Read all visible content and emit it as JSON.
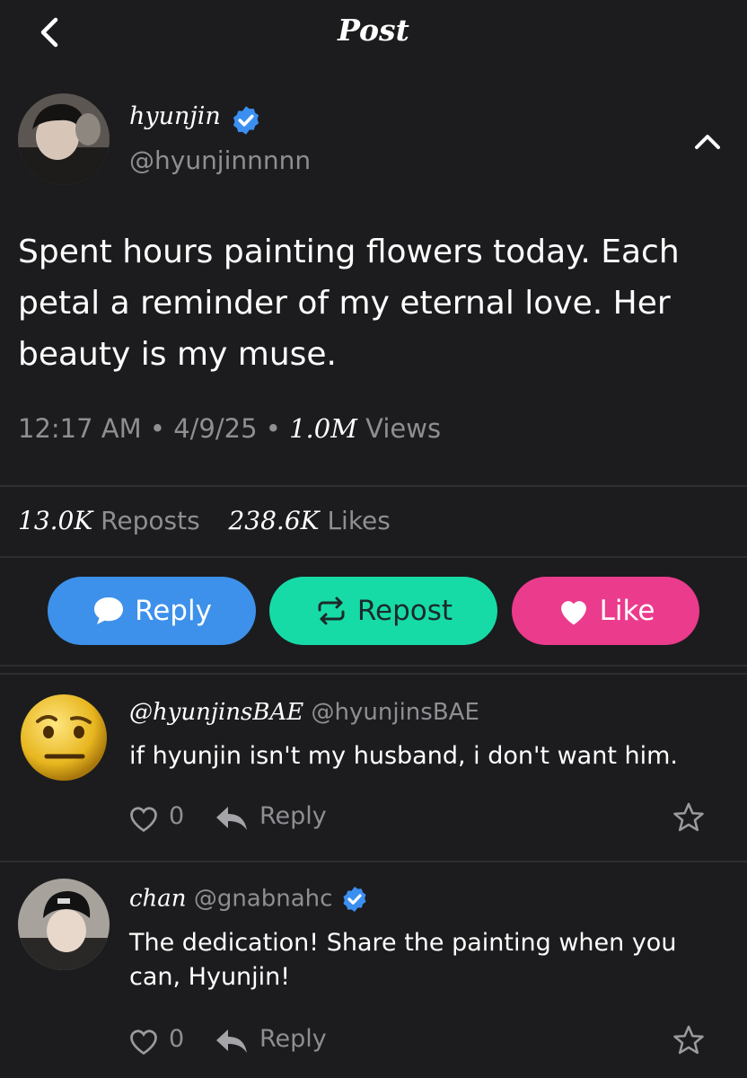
{
  "header": {
    "title": "Post"
  },
  "post": {
    "author_name": "hyunjin",
    "author_handle": "@hyunjinnnnn",
    "text": "Spent hours painting flowers today. Each petal a reminder of my eternal love. Her beauty is my muse.",
    "time": "12:17 AM",
    "date": "4/9/25",
    "views_count": "1.0M",
    "views_label": "Views",
    "reposts_count": "13.0K",
    "reposts_label": "Reposts",
    "likes_count": "238.6K",
    "likes_label": "Likes"
  },
  "actions": {
    "reply": "Reply",
    "repost": "Repost",
    "like": "Like"
  },
  "comments": [
    {
      "name": "@hyunjinsBAE",
      "handle": "@hyunjinsBAE",
      "text": "if hyunjin isn't my husband, i don't want him.",
      "likes": "0",
      "reply_label": "Reply"
    },
    {
      "name": "chan",
      "handle": "@gnabnahc",
      "text": "The dedication! Share the painting when you can, Hyunjin!",
      "likes": "0",
      "reply_label": "Reply"
    }
  ],
  "colors": {
    "background": "#1c1c1e",
    "reply": "#3d91ea",
    "repost": "#17dba6",
    "like": "#eb3b8c",
    "verified": "#3b8ff0"
  },
  "icons": [
    "back-icon",
    "verified-badge-icon",
    "collapse-chevron-icon",
    "speech-bubble-icon",
    "repost-arrows-icon",
    "heart-icon",
    "reply-arrow-icon",
    "star-icon"
  ]
}
